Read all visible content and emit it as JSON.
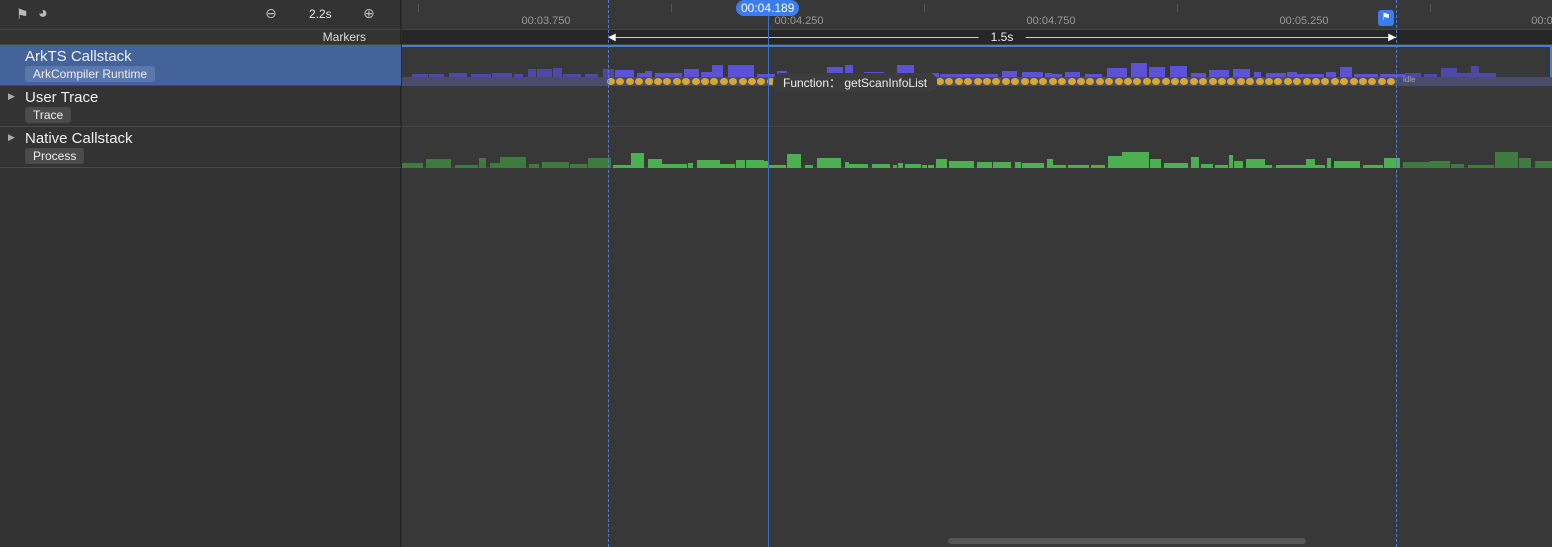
{
  "toolbar": {
    "zoom_value": "2.2s",
    "flag_icon": "flag-icon",
    "compass_icon": "compass-icon",
    "zoom_out_icon": "minus-circle-icon",
    "zoom_in_icon": "plus-circle-icon"
  },
  "markers_label": "Markers",
  "lanes": [
    {
      "title": "ArkTS Callstack",
      "badge": "ArkCompiler Runtime",
      "selected": true
    },
    {
      "title": "User Trace",
      "badge": "Trace"
    },
    {
      "title": "Native Callstack",
      "badge": "Process"
    }
  ],
  "ruler": {
    "ticks": [
      "00:03.750",
      "00:04.250",
      "00:04.750",
      "00:05.250",
      "00:0"
    ]
  },
  "cursor": {
    "time": "00:04.189"
  },
  "selection": {
    "duration": "1.5s"
  },
  "tooltip": {
    "label": "Function：",
    "value": "getScanInfoList"
  },
  "idle_label": "idle",
  "short_label": "...",
  "colors": {
    "accent": "#3b7cf0",
    "selected_lane": "#44639a",
    "ark_bar": "#5b52d6",
    "native_bar": "#4caf50",
    "call_dot": "#d9a72c"
  }
}
